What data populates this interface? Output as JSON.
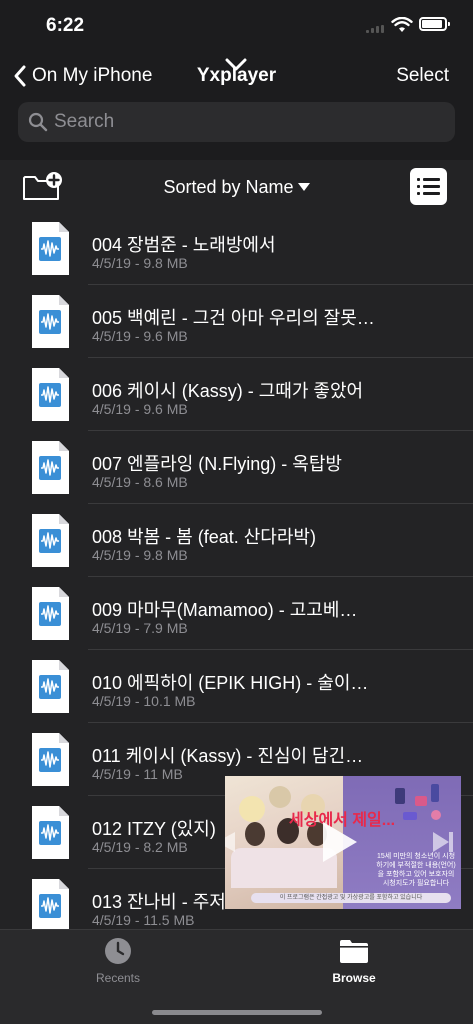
{
  "status_bar": {
    "time": "6:22"
  },
  "nav": {
    "back_label": "On My iPhone",
    "title": "Yxplayer",
    "select_label": "Select"
  },
  "search": {
    "placeholder": "Search"
  },
  "toolbar": {
    "sort_label": "Sorted by Name"
  },
  "files": [
    {
      "name": "004 장범준 - 노래방에서",
      "meta": "4/5/19 - 9.8 MB"
    },
    {
      "name": "005 백예린 - 그건 아마 우리의 잘못…",
      "meta": "4/5/19 - 9.6 MB"
    },
    {
      "name": "006 케이시 (Kassy) - 그때가 좋았어",
      "meta": "4/5/19 - 9.6 MB"
    },
    {
      "name": "007 엔플라잉 (N.Flying) - 옥탑방",
      "meta": "4/5/19 - 8.6 MB"
    },
    {
      "name": "008 박봄 - 봄 (feat. 산다라박)",
      "meta": "4/5/19 - 9.8 MB"
    },
    {
      "name": "009 마마무(Mamamoo) - 고고베…",
      "meta": "4/5/19 - 7.9 MB"
    },
    {
      "name": "010 에픽하이 (EPIK HIGH) - 술이…",
      "meta": "4/5/19 - 10.1 MB"
    },
    {
      "name": "011 케이시 (Kassy) - 진심이 담긴…",
      "meta": "4/5/19 - 11 MB"
    },
    {
      "name": "012 ITZY (있지)",
      "meta": "4/5/19 - 8.2 MB"
    },
    {
      "name": "013 잔나비 - 주저",
      "meta": "4/5/19 - 11.5 MB"
    }
  ],
  "ad": {
    "headline": "세상에서 제일...",
    "notice": "15세 미만의 청소년이 시청하기에 부적절한 내용(언어)을 포함하고 있어 보호자의 시청지도가 필요합니다",
    "footer": "이 프로그램은 간접광고 및 가상광고를 포함하고 있습니다"
  },
  "tabs": {
    "recents_label": "Recents",
    "browse_label": "Browse"
  },
  "colors": {
    "background": "#1c1c1e",
    "list_background": "#232325",
    "file_icon_accent": "#3a8fd6",
    "ad_headline": "#e8294b"
  }
}
